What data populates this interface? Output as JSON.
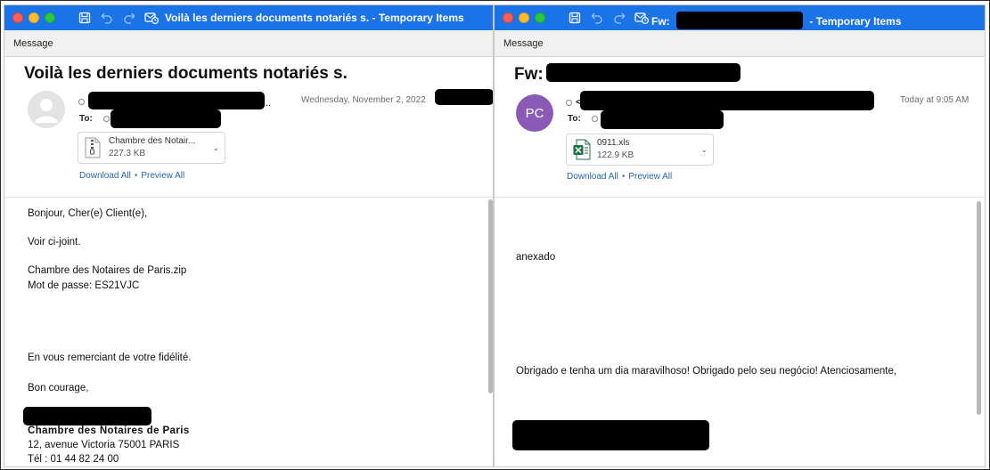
{
  "window_left": {
    "title": "Voilà les derniers documents notariés s. - Temporary Items",
    "ribbon_tab": "Message",
    "subject": "Voilà les derniers documents notariés s.",
    "sender_ellipsis": "..",
    "date": "Wednesday, November 2, 2022",
    "to_label": "To:",
    "attachment": {
      "name": "Chambre des Notair...",
      "size": "227.3 KB"
    },
    "download_all": "Download All",
    "link_separator": "•",
    "preview_all": "Preview All",
    "body": {
      "greeting": "Bonjour, Cher(e) Client(e),",
      "line1": "Voir ci-joint.",
      "line2": "Chambre des Notaires de Paris.zip",
      "line3": "Mot de passe: ES21VJC",
      "line4": "En vous remerciant de votre fidélité.",
      "line5": "Bon courage,",
      "sig_org": "Chambre des Notaires de Paris",
      "sig_address": "12, avenue Victoria 75001 PARIS",
      "sig_phone": "Tél : 01 44 82 24 00"
    }
  },
  "window_right": {
    "title_prefix": "Fw:",
    "title_suffix": "- Temporary Items",
    "ribbon_tab": "Message",
    "subject_prefix": "Fw:",
    "avatar_initials": "PC",
    "sender_prefix": "<",
    "date": "Today at 9:05 AM",
    "to_label": "To:",
    "attachment": {
      "name": "0911.xls",
      "size": "122.9 KB"
    },
    "download_all": "Download All",
    "link_separator": "•",
    "preview_all": "Preview All",
    "body": {
      "line1": "anexado",
      "line2": "Obrigado e tenha um dia maravilhoso! Obrigado pelo seu negócio! Atenciosamente,"
    }
  },
  "colors": {
    "titlebar": "#1b73e8",
    "link": "#2866a8",
    "avatar_purple": "#8a5bb6",
    "excel_green": "#1e7145"
  },
  "icons": [
    "save-icon",
    "undo-icon",
    "redo-icon",
    "scheduled-send-icon",
    "zip-file-icon",
    "excel-file-icon",
    "chevron-down-icon",
    "default-avatar-icon"
  ]
}
